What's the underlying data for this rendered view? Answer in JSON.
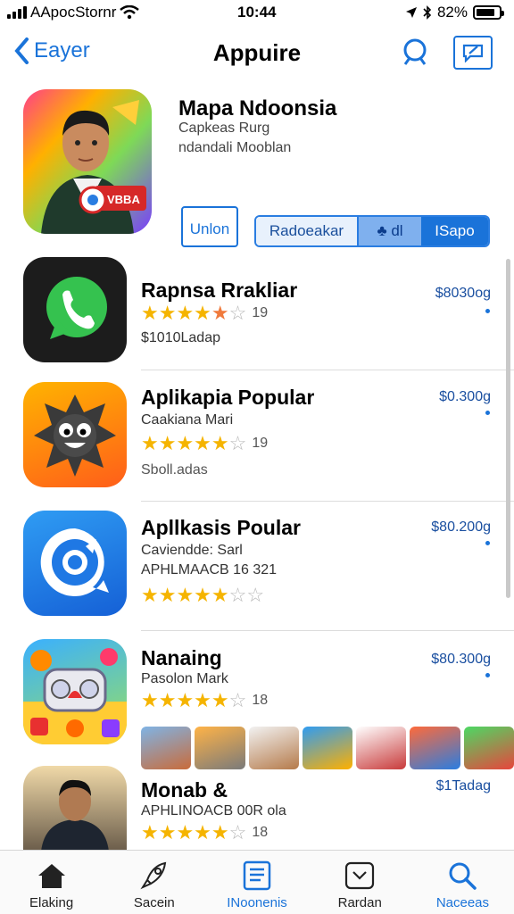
{
  "status": {
    "carrier": "AApocStornr",
    "time": "10:44",
    "battery": "82%"
  },
  "nav": {
    "back_label": "Eayer",
    "title": "Appuire"
  },
  "featured": {
    "title": "Mapa Ndoonsia",
    "subtitle1": "Capkeas Rurg",
    "subtitle2": "ndandali Mooblan",
    "badge": "VBBA",
    "union_label": "Unlon",
    "segments": [
      "Radoeakar",
      "♣ dl",
      "ISapo"
    ]
  },
  "apps": [
    {
      "name": "Rapnsa Rrakliar",
      "price": "$8030og",
      "sub": "$1010Ladap",
      "rating": 4.5,
      "count": "19"
    },
    {
      "name": "Aplikapia Popular",
      "price": "$0.300g",
      "sub": "Caakiana Mari",
      "sub2": "Sboll.adas",
      "rating": 4,
      "count": "19"
    },
    {
      "name": "Apllkasis Poular",
      "price": "$80.200g",
      "sub": "Caviendde: Sarl",
      "sub2": "APHLMAACB 16 321",
      "rating": 4,
      "count": ""
    },
    {
      "name": "Nanaing",
      "price": "$80.300g",
      "sub": "Pasolon Mark",
      "rating": 4,
      "count": "18"
    },
    {
      "name": "Monab &",
      "price": "$1Tadag",
      "sub": "APHLINOACB 00R ola",
      "rating": 4,
      "count": "18"
    }
  ],
  "tabs": [
    {
      "label": "Elaking",
      "icon": "home-icon"
    },
    {
      "label": "Sacein",
      "icon": "rocket-icon"
    },
    {
      "label": "INoonenis",
      "icon": "list-icon",
      "active": true
    },
    {
      "label": "Rardan",
      "icon": "inbox-icon"
    },
    {
      "label": "Naceeas",
      "icon": "search-icon",
      "active": true
    }
  ],
  "colors": {
    "accent": "#1a73d9",
    "star": "#f5b400"
  }
}
